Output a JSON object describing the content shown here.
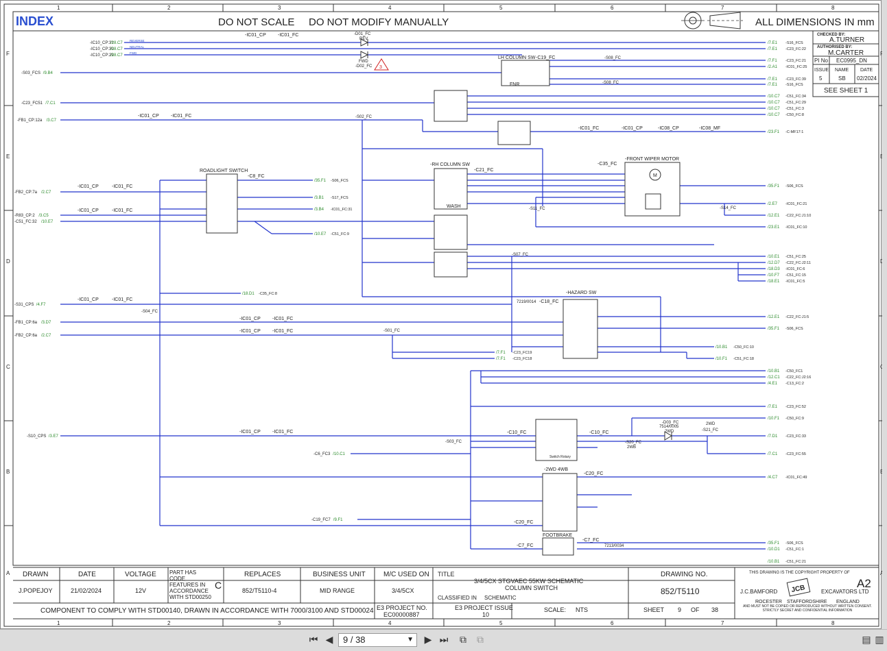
{
  "header": {
    "index": "INDEX",
    "do_not_scale": "DO NOT SCALE",
    "do_not_modify": "DO NOT MODIFY MANUALLY",
    "all_dimensions": "ALL DIMENSIONS IN mm"
  },
  "grid": {
    "columns": [
      "1",
      "2",
      "3",
      "4",
      "5",
      "6",
      "7",
      "8"
    ],
    "rows": [
      "F",
      "E",
      "D",
      "C",
      "B",
      "A"
    ]
  },
  "approval": {
    "checked_by_label": "CHECKED BY:",
    "checked_by": "A.TURNER",
    "authorised_by_label": "AUTHORISED BY:",
    "authorised_by": "M.CARTER",
    "pi_no_label": "PI No",
    "pi_no": "EC0995_DN",
    "issue_label": "ISSUE",
    "name_label": "NAME",
    "date_label": "DATE",
    "issue": "5",
    "name": "SB",
    "date": "02/2024",
    "see_sheet": "SEE SHEET 1"
  },
  "components": {
    "lh_column_sw": "LH COLUMN SW",
    "rh_column_sw": "-RH COLUMN SW",
    "roadlight_switch": "ROADLIGHT SWITCH",
    "front_wiper_motor": "-FRONT WIPER MOTOR",
    "hazard_sw": "-HAZARD SW",
    "fnr": "FNR",
    "wash": "WASH",
    "two_wd_4wb": "-2WD 4WB",
    "footbrake": "FOOTBRAKE",
    "d01": "-D01_FC",
    "d02": "-D02_FC",
    "d03": "-D03_FC",
    "rev": "REV",
    "fwd": "FWD",
    "two_wd": "2WD",
    "two_wb": "2WB",
    "switch_rotary": "Switch Rotary",
    "c19": "-C19_FC",
    "c21": "-C21_FC",
    "c35": "-C35_FC",
    "c8": "-C8_FC",
    "c18": "-C18_FC",
    "c10a": "-C10_FC",
    "c10b": "-C10_FC",
    "c20a": "-C20_FC",
    "c20b": "-C20_FC",
    "c7a": "-C7_FC",
    "c7b": "-C7_FC",
    "s02": "-S02_FC",
    "s01": "-S01_FC",
    "s03": "-S03_FC",
    "s07": "-S07_FC",
    "s08a": "-S08_FC",
    "s08b": "-S08_FC",
    "s11": "-S11_FC",
    "s14": "-S14_FC",
    "s04": "-S04_FC",
    "s20": "-S20_FC",
    "s21": "-S21_FC",
    "ic01_cp": "-IC01_CP",
    "ic01_fc": "-IC01_FC",
    "ic08_cp": "-IC08_CP",
    "ic08_mf": "-IC08_MF",
    "part_7219": "7219/0014",
    "part_7514": "7514/0005",
    "part_7213": "7213/0034",
    "warn": "3"
  },
  "left_refs": [
    {
      "id": "-S03_FCS",
      "ref": "/9.B4"
    },
    {
      "id": "-C23_FC51",
      "ref": "/7.C1"
    },
    {
      "id": "-FB1_CP:12a",
      "ref": "/3.C7"
    },
    {
      "id": "-FB2_CP:7a",
      "ref": "/2.C7"
    },
    {
      "id": "-R83_CP:2",
      "ref": "/3.C5"
    },
    {
      "id": "-C51_FC:32",
      "ref": "/10.E7"
    },
    {
      "id": "-S31_CPS",
      "ref": "/4.F7"
    },
    {
      "id": "-FB1_CP:6a",
      "ref": "/3.D7"
    },
    {
      "id": "-FB2_CP:6a",
      "ref": "/2.C7"
    },
    {
      "id": "-S10_CPS",
      "ref": "/3.E7"
    },
    {
      "id": "-C6_FC3",
      "ref": "/10.C1"
    },
    {
      "id": "-C19_FC7",
      "ref": "/9.F1"
    }
  ],
  "top_left_refs": [
    {
      "id": "-IC10_CP:31",
      "ref": "/28.C7",
      "sig": "REVERSE"
    },
    {
      "id": "-IC10_CP:30",
      "ref": "/28.C7",
      "sig": "NEUTRAL"
    },
    {
      "id": "-IC10_CP:29",
      "ref": "/28.C7",
      "sig": "FWD"
    }
  ],
  "right_refs": [
    {
      "ref": "/7.E1",
      "id": "-S16_FCS"
    },
    {
      "ref": "/7.E1",
      "id": "-C23_FC:22"
    },
    {
      "ref": "/7.F1",
      "id": "-C23_FC:21"
    },
    {
      "ref": "/2.A1",
      "id": "-IC01_FC:25"
    },
    {
      "ref": "/7.E1",
      "id": "-C23_FC:39"
    },
    {
      "ref": "/7.E1",
      "id": "-S16_FCS"
    },
    {
      "ref": "/10.C7",
      "id": "-C51_FC:34"
    },
    {
      "ref": "/10.C7",
      "id": "-C51_FC:29"
    },
    {
      "ref": "/10.C7",
      "id": "-C51_FC:3"
    },
    {
      "ref": "/10.C7",
      "id": "-C50_FC:8"
    },
    {
      "ref": "/23.F1",
      "id": "-C-MF17:1"
    },
    {
      "ref": "/35.F1",
      "id": "-S06_FCS"
    },
    {
      "ref": "/2.E7",
      "id": "-IC01_FC:21"
    },
    {
      "ref": "/12.E1",
      "id": "-C22_FC:J1:10"
    },
    {
      "ref": "/23.E1",
      "id": "-IC01_FC:10"
    },
    {
      "ref": "/10.E1",
      "id": "-C51_FC:25"
    },
    {
      "ref": "/12.D7",
      "id": "-C22_FC:J2:11"
    },
    {
      "ref": "/18.D3",
      "id": "-IC01_FC:6"
    },
    {
      "ref": "/10.F7",
      "id": "-C51_FC:15"
    },
    {
      "ref": "/18.E1",
      "id": "-IC01_FC:5"
    },
    {
      "ref": "/12.E1",
      "id": "-C22_FC:J1:5"
    },
    {
      "ref": "/35.F1",
      "id": "-S06_FCS"
    },
    {
      "ref": "/10.B1",
      "id": "-C50_FC:10"
    },
    {
      "ref": "/10.F1",
      "id": "-C51_FC:18"
    },
    {
      "ref": "/10.B1",
      "id": "-C50_FC1"
    },
    {
      "ref": "/12.C1",
      "id": "-C22_FC:J2:16"
    },
    {
      "ref": "/4.E1",
      "id": "-C13_FC:2"
    },
    {
      "ref": "/7.E1",
      "id": "-C23_FC:52"
    },
    {
      "ref": "/10.F1",
      "id": "-C50_FC:9"
    },
    {
      "ref": "/7.D1",
      "id": "-C23_FC:33"
    },
    {
      "ref": "/7.C1",
      "id": "-C23_FC:55"
    },
    {
      "ref": "/4.C7",
      "id": "-IC01_FC:49"
    },
    {
      "ref": "/35.F1",
      "id": "-S06_FCS"
    },
    {
      "ref": "/10.D1",
      "id": "-C51_FC:1"
    },
    {
      "ref": "/10.B1",
      "id": "-C51_FC:21"
    }
  ],
  "mid_refs": [
    {
      "ref": "/35.F1",
      "id": "-S06_FCS"
    },
    {
      "ref": "/3.B1",
      "id": "-S17_FCS"
    },
    {
      "ref": "/3.B4",
      "id": "-IC01_FC:31"
    },
    {
      "ref": "/10.E7",
      "id": "-C51_FC:9"
    },
    {
      "ref": "/18.D1",
      "id": "-C35_FC:8"
    },
    {
      "ref": "/7.F1",
      "id": "-C23_FC19"
    },
    {
      "ref": "/7.F1",
      "id": "-C23_FC18"
    }
  ],
  "title_block": {
    "drawn_label": "DRAWN",
    "drawn": "J.POPEJOY",
    "date_label": "DATE",
    "date": "21/02/2024",
    "voltage_label": "VOLTAGE",
    "voltage": "12V",
    "part_code_text": "PART HAS CODE FEATURES IN ACCORDANCE WITH STD00250",
    "part_code": "C",
    "replaces_label": "REPLACES",
    "replaces": "852/T5110-4",
    "business_unit_label": "BUSINESS UNIT",
    "business_unit": "MID RANGE",
    "mc_used_on_label": "M/C USED ON",
    "mc_used_on": "3/4/5CX",
    "title_label": "TITLE",
    "title_line1": "3/4/5CX STGVAEC 55KW SCHEMATIC",
    "title_line2": "COLUMN SWITCH",
    "classified_label": "CLASSIFIED IN",
    "classified": "SCHEMATIC",
    "drawing_no_label": "DRAWING NO.",
    "drawing_no": "852/T5110",
    "size": "A2",
    "copyright": "THIS DRAWING IS THE COPYRIGHT PROPERTY OF",
    "company": "J.C.BAMFORD",
    "company2": "EXCAVATORS LTD",
    "logo": "JCB",
    "addr1": "ROCESTER",
    "addr2": "STAFFORDSHIRE",
    "addr3": "ENGLAND",
    "legal": "AND MUST NOT BE COPIED OR REPRODUCED WITHOUT WRITTEN CONSENT. STRICTLY SECRET AND CONFIDENTIAL INFORMATION",
    "component_note": "COMPONENT TO COMPLY WITH STD00140, DRAWN IN ACCORDANCE WITH 7000/3100 AND STD00024",
    "e3_project_no_label": "E3 PROJECT NO.",
    "e3_project_no": "EC00000887",
    "e3_project_issue_label": "E3 PROJECT ISSUE",
    "e3_project_issue": "10",
    "scale_label": "SCALE:",
    "scale": "NTS",
    "sheet_label": "SHEET",
    "sheet": "9",
    "of_label": "OF",
    "of": "38"
  },
  "toolbar": {
    "page_value": "9 / 38",
    "first_icon": "first-page-icon",
    "prev_icon": "prev-page-icon",
    "next_icon": "next-page-icon",
    "last_icon": "last-page-icon"
  }
}
